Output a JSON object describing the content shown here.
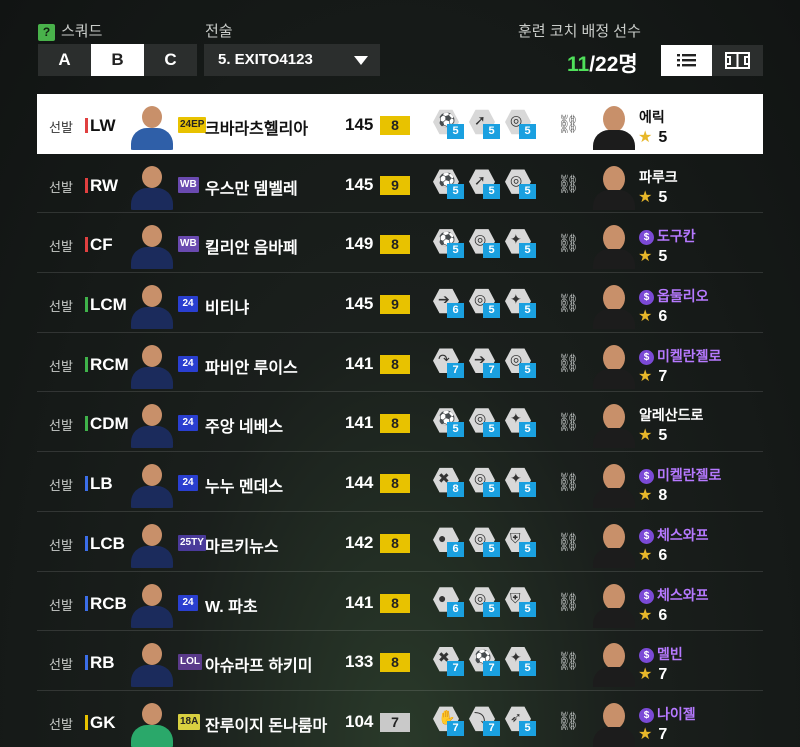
{
  "header": {
    "help_icon": "?",
    "squad_label": "스쿼드",
    "tactic_label": "전술",
    "coach_label": "훈련 코치 배정 선수",
    "squad_tabs": [
      "A",
      "B",
      "C"
    ],
    "active_tab": "B",
    "tactic_value": "5. EXITO4123",
    "count_assigned": "11",
    "count_total": "/22명",
    "view_icons": [
      "list-view-icon",
      "field-view-icon"
    ]
  },
  "rows": [
    {
      "start": "선발",
      "pos": "LW",
      "pos_color": "#e04040",
      "season": "24EP",
      "season_bg": "#e8c200",
      "season_fg": "#222",
      "name": "크바라츠헬리아",
      "ovr": "145",
      "grade": "8",
      "grade_bg": "#e8c200",
      "skills": [
        {
          "icon": "dribble-icon",
          "lvl": "5"
        },
        {
          "icon": "speed-icon",
          "lvl": "5"
        },
        {
          "icon": "finish-icon",
          "lvl": "5"
        }
      ],
      "coach": "에릭",
      "coach_paid": false,
      "stars": "5",
      "kit": "#2f5fa8"
    },
    {
      "start": "선발",
      "pos": "RW",
      "pos_color": "#e04040",
      "season": "WB",
      "season_bg": "#6a4ab0",
      "season_fg": "#fff",
      "name": "우스만 뎀벨레",
      "ovr": "145",
      "grade": "9",
      "grade_bg": "#e8c200",
      "skills": [
        {
          "icon": "dribble-icon",
          "lvl": "5"
        },
        {
          "icon": "speed-icon",
          "lvl": "5"
        },
        {
          "icon": "finish-icon",
          "lvl": "5"
        }
      ],
      "coach": "파루크",
      "coach_paid": false,
      "stars": "5",
      "kit": "#1b2b5c"
    },
    {
      "start": "선발",
      "pos": "CF",
      "pos_color": "#e04040",
      "season": "WB",
      "season_bg": "#6a4ab0",
      "season_fg": "#fff",
      "name": "킬리안 음바페",
      "ovr": "149",
      "grade": "8",
      "grade_bg": "#e8c200",
      "skills": [
        {
          "icon": "dribble-icon",
          "lvl": "5"
        },
        {
          "icon": "finish-icon",
          "lvl": "5"
        },
        {
          "icon": "shot-icon",
          "lvl": "5"
        }
      ],
      "coach": "도구칸",
      "coach_paid": true,
      "stars": "5",
      "kit": "#1b2b5c"
    },
    {
      "start": "선발",
      "pos": "LCM",
      "pos_color": "#3fb24a",
      "season": "24",
      "season_bg": "#2a3fd0",
      "season_fg": "#fff",
      "name": "비티냐",
      "ovr": "145",
      "grade": "9",
      "grade_bg": "#e8c200",
      "skills": [
        {
          "icon": "pass-icon",
          "lvl": "6"
        },
        {
          "icon": "finish-icon",
          "lvl": "5"
        },
        {
          "icon": "shot-icon",
          "lvl": "5"
        }
      ],
      "coach": "옵둘리오",
      "coach_paid": true,
      "stars": "6",
      "kit": "#1b2b5c"
    },
    {
      "start": "선발",
      "pos": "RCM",
      "pos_color": "#3fb24a",
      "season": "24",
      "season_bg": "#2a3fd0",
      "season_fg": "#fff",
      "name": "파비안 루이스",
      "ovr": "141",
      "grade": "8",
      "grade_bg": "#e8c200",
      "skills": [
        {
          "icon": "cross-icon",
          "lvl": "7"
        },
        {
          "icon": "pass-icon",
          "lvl": "7"
        },
        {
          "icon": "finish-icon",
          "lvl": "5"
        }
      ],
      "coach": "미켈란젤로",
      "coach_paid": true,
      "stars": "7",
      "kit": "#1b2b5c"
    },
    {
      "start": "선발",
      "pos": "CDM",
      "pos_color": "#3fb24a",
      "season": "24",
      "season_bg": "#2a3fd0",
      "season_fg": "#fff",
      "name": "주앙 네베스",
      "ovr": "141",
      "grade": "8",
      "grade_bg": "#e8c200",
      "skills": [
        {
          "icon": "dribble-icon",
          "lvl": "5"
        },
        {
          "icon": "finish-icon",
          "lvl": "5"
        },
        {
          "icon": "shot-icon",
          "lvl": "5"
        }
      ],
      "coach": "알레산드로",
      "coach_paid": false,
      "stars": "5",
      "kit": "#1b2b5c"
    },
    {
      "start": "선발",
      "pos": "LB",
      "pos_color": "#3b6ee8",
      "season": "24",
      "season_bg": "#2a3fd0",
      "season_fg": "#fff",
      "name": "누누 멘데스",
      "ovr": "144",
      "grade": "8",
      "grade_bg": "#e8c200",
      "skills": [
        {
          "icon": "tackle-icon",
          "lvl": "8"
        },
        {
          "icon": "finish-icon",
          "lvl": "5"
        },
        {
          "icon": "shot-icon",
          "lvl": "5"
        }
      ],
      "coach": "미켈란젤로",
      "coach_paid": true,
      "stars": "8",
      "kit": "#1b2b5c"
    },
    {
      "start": "선발",
      "pos": "LCB",
      "pos_color": "#3b6ee8",
      "season": "25TY",
      "season_bg": "#4a3a9a",
      "season_fg": "#fff",
      "name": "마르키뉴스",
      "ovr": "142",
      "grade": "8",
      "grade_bg": "#e8c200",
      "skills": [
        {
          "icon": "header-icon",
          "lvl": "6"
        },
        {
          "icon": "finish-icon",
          "lvl": "5"
        },
        {
          "icon": "shield-icon",
          "lvl": "5"
        }
      ],
      "coach": "체스와프",
      "coach_paid": true,
      "stars": "6",
      "kit": "#1b2b5c"
    },
    {
      "start": "선발",
      "pos": "RCB",
      "pos_color": "#3b6ee8",
      "season": "24",
      "season_bg": "#2a3fd0",
      "season_fg": "#fff",
      "name": "W. 파초",
      "ovr": "141",
      "grade": "8",
      "grade_bg": "#e8c200",
      "skills": [
        {
          "icon": "header-icon",
          "lvl": "6"
        },
        {
          "icon": "finish-icon",
          "lvl": "5"
        },
        {
          "icon": "shield-icon",
          "lvl": "5"
        }
      ],
      "coach": "체스와프",
      "coach_paid": true,
      "stars": "6",
      "kit": "#1b2b5c"
    },
    {
      "start": "선발",
      "pos": "RB",
      "pos_color": "#3b6ee8",
      "season": "LOL",
      "season_bg": "#5a3a8a",
      "season_fg": "#fff",
      "name": "아슈라프 하키미",
      "ovr": "133",
      "grade": "8",
      "grade_bg": "#e8c200",
      "skills": [
        {
          "icon": "tackle-icon",
          "lvl": "7"
        },
        {
          "icon": "dribble-icon",
          "lvl": "7"
        },
        {
          "icon": "shot-icon",
          "lvl": "5"
        }
      ],
      "coach": "멜빈",
      "coach_paid": true,
      "stars": "7",
      "kit": "#1b2b5c"
    },
    {
      "start": "선발",
      "pos": "GK",
      "pos_color": "#e8c200",
      "season": "18A",
      "season_bg": "#d8d040",
      "season_fg": "#222",
      "name": "잔루이지 돈나룸마",
      "ovr": "104",
      "grade": "7",
      "grade_bg": "#c9c9c9",
      "skills": [
        {
          "icon": "glove-icon",
          "lvl": "7"
        },
        {
          "icon": "dive-icon",
          "lvl": "7"
        },
        {
          "icon": "kick-icon",
          "lvl": "5"
        }
      ],
      "coach": "나이젤",
      "coach_paid": true,
      "stars": "7",
      "kit": "#2aa86a"
    }
  ]
}
